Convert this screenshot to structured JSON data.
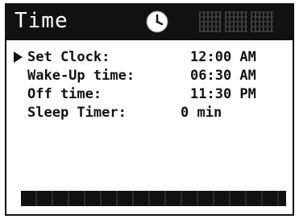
{
  "header": {
    "title": "Time",
    "icons": [
      "clock-icon",
      "status-icon",
      "status-icon",
      "status-icon"
    ]
  },
  "menu": {
    "items": [
      {
        "label": "Set Clock:",
        "value": "12:00 AM",
        "selected": true
      },
      {
        "label": "Wake-Up time:",
        "value": "06:30 AM",
        "selected": false
      },
      {
        "label": "Off time:",
        "value": "11:30 PM",
        "selected": false
      },
      {
        "label": "Sleep Timer:",
        "value": "0 min",
        "selected": false
      }
    ]
  },
  "colors": {
    "foreground": "#111111",
    "background": "#ffffff"
  }
}
